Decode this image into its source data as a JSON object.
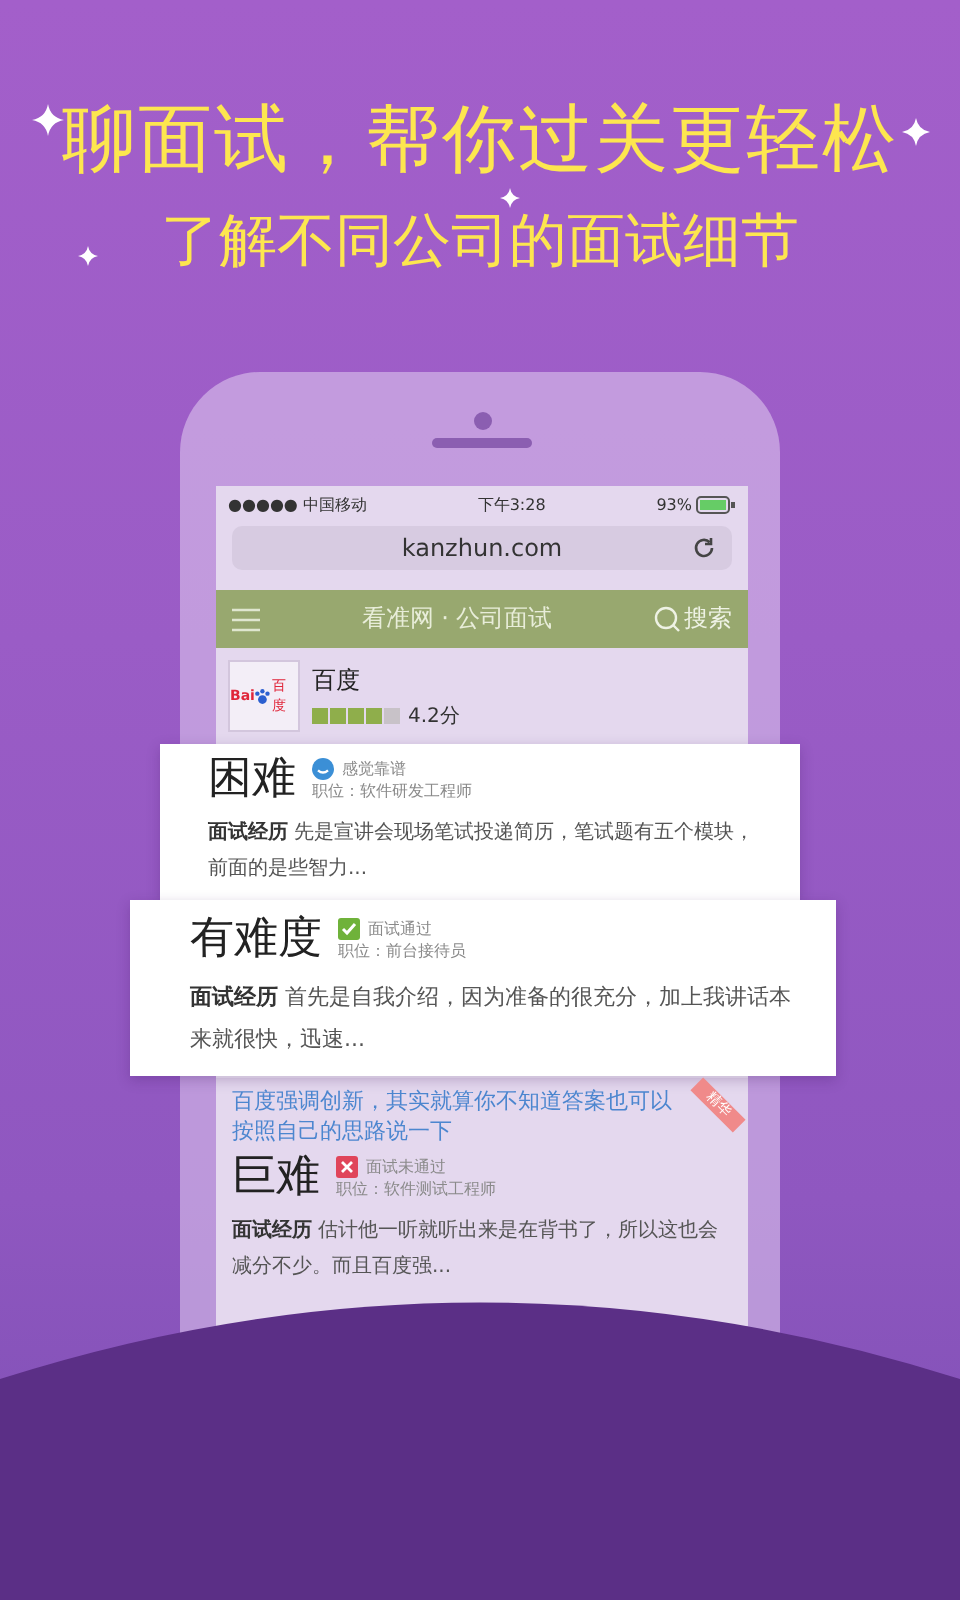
{
  "headline": "聊面试，帮你过关更轻松",
  "subheadline": "了解不同公司的面试细节",
  "status_bar": {
    "carrier": "●●●●● 中国移动",
    "time": "下午3:28",
    "battery": "93%"
  },
  "address_bar": {
    "url": "kanzhun.com"
  },
  "nav": {
    "title": "看准网 · 公司面试",
    "search": "搜索"
  },
  "company": {
    "logo_left": "Bai",
    "logo_right": "百度",
    "name": "百度",
    "stars": 4,
    "rating": "4.2分"
  },
  "reviews": [
    {
      "elevated": true,
      "difficulty": "困难",
      "result": {
        "kind": "neutral",
        "text": "感觉靠谱"
      },
      "position": "职位：软件研发工程师",
      "label": "面试经历",
      "text": "先是宣讲会现场笔试投递简历，笔试题有五个模块，前面的是些智力..."
    },
    {
      "elevated": true,
      "difficulty": "有难度",
      "result": {
        "kind": "pass",
        "text": "面试通过"
      },
      "position": "职位：前台接待员",
      "label": "面试经历",
      "text": "首先是自我介绍，因为准备的很充分，加上我讲话本来就很快，迅速..."
    },
    {
      "elevated": false,
      "title": "百度强调创新，其实就算你不知道答案也可以按照自己的思路说一下",
      "badge": "精华",
      "difficulty": "巨难",
      "result": {
        "kind": "fail",
        "text": "面试未通过"
      },
      "position": "职位：软件测试工程师",
      "label": "面试经历",
      "text": "估计他一听就听出来是在背书了，所以这也会减分不少。而且百度强..."
    }
  ]
}
